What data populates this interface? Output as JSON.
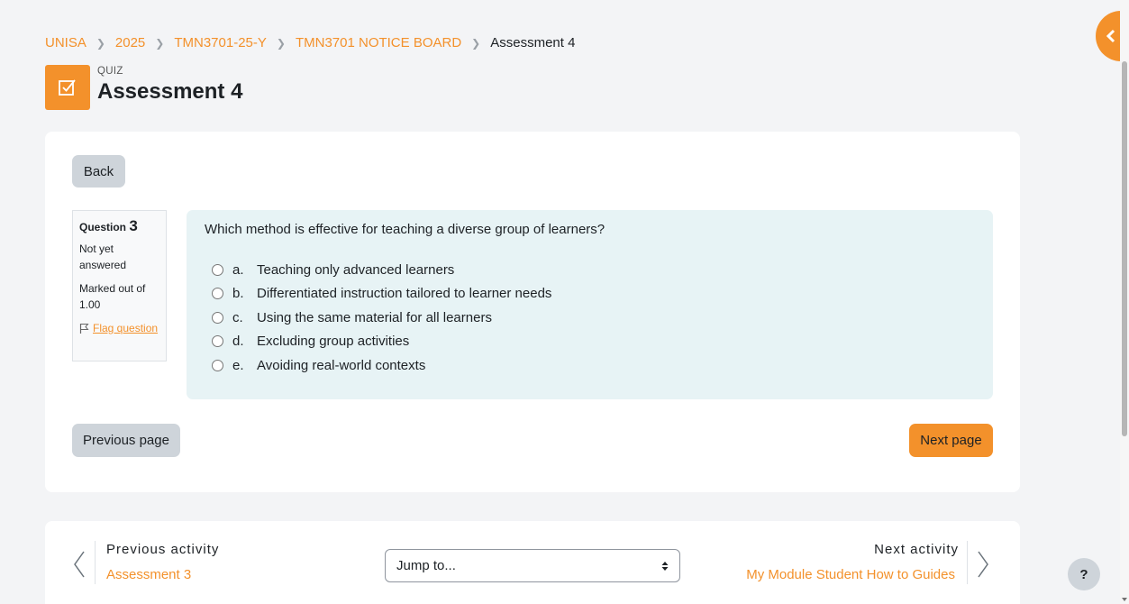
{
  "breadcrumb": {
    "items": [
      "UNISA",
      "2025",
      "TMN3701-25-Y",
      "TMN3701 NOTICE BOARD"
    ],
    "current": "Assessment 4"
  },
  "header": {
    "activity_type": "QUIZ",
    "title": "Assessment 4",
    "icon": "checkbox-edit-icon",
    "accent": "#f3912b"
  },
  "controls": {
    "back_label": "Back",
    "previous_page_label": "Previous page",
    "next_page_label": "Next page"
  },
  "question_info": {
    "label": "Question",
    "number": "3",
    "state": "Not yet answered",
    "grade": "Marked out of 1.00",
    "flag_label": "Flag question"
  },
  "question": {
    "text": "Which method is effective for teaching a diverse group of learners?",
    "answers": [
      {
        "letter": "a.",
        "text": "Teaching only advanced learners"
      },
      {
        "letter": "b.",
        "text": "Differentiated instruction tailored to learner needs"
      },
      {
        "letter": "c.",
        "text": "Using the same material for all learners"
      },
      {
        "letter": "d.",
        "text": "Excluding group activities"
      },
      {
        "letter": "e.",
        "text": "Avoiding real-world contexts"
      }
    ]
  },
  "activity_nav": {
    "previous_heading": "Previous activity",
    "previous_link": "Assessment 3",
    "jump_placeholder": "Jump to...",
    "next_heading": "Next activity",
    "next_link": "My Module Student How to Guides"
  },
  "help": {
    "label": "?"
  }
}
